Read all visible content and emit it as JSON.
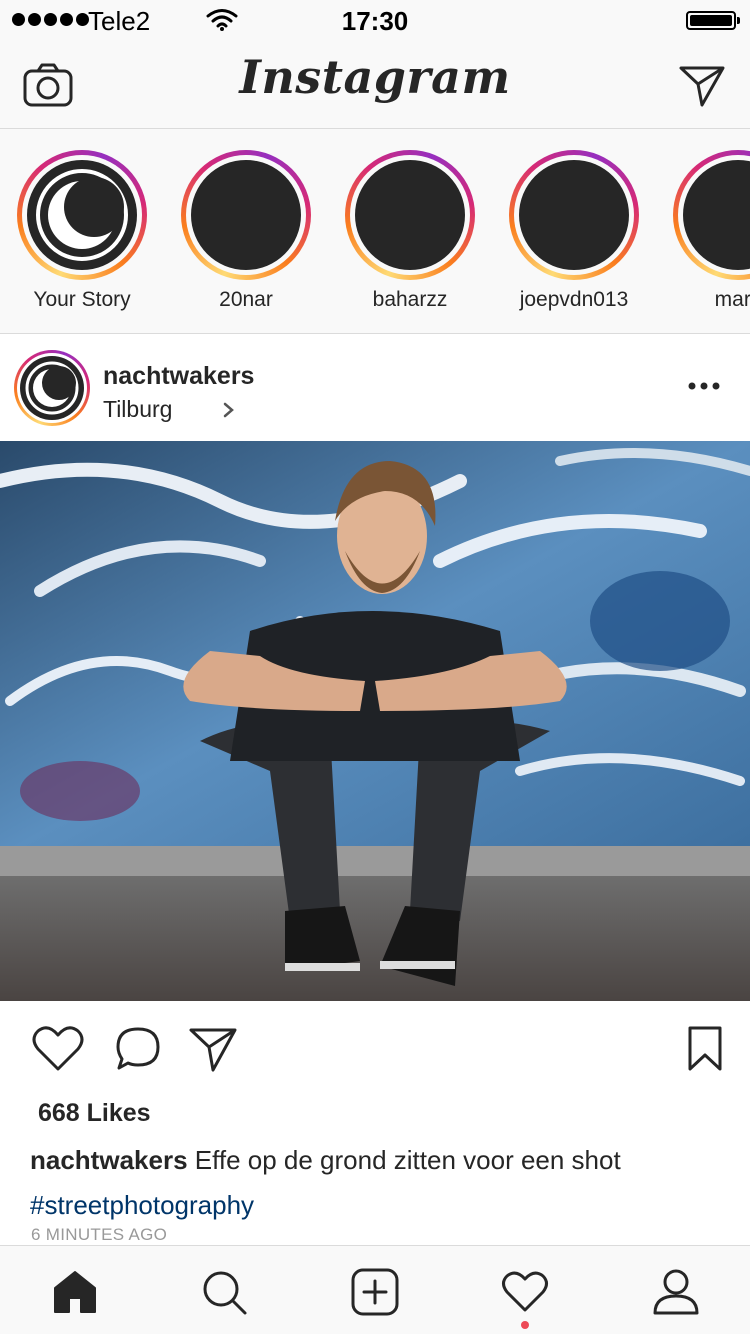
{
  "status_bar": {
    "carrier": "Tele2",
    "time": "17:30",
    "icons": [
      "signal-dots-icon",
      "wifi-icon",
      "battery-icon"
    ]
  },
  "header": {
    "logo": "Instagram",
    "icons": [
      "camera-icon",
      "direct-message-icon"
    ]
  },
  "stories": [
    {
      "name": "Your Story",
      "logo": true
    },
    {
      "name": "20nar"
    },
    {
      "name": "baharzz"
    },
    {
      "name": "joepvdn013"
    },
    {
      "name": "mark"
    }
  ],
  "post": {
    "username": "nachtwakers",
    "location": "Tilburg",
    "likes": "668 Likes",
    "caption_user": "nachtwakers",
    "caption_text": "Effe op de grond zitten voor een shot",
    "hashtag": "#streetphotography",
    "time_ago": "6 MINUTES AGO",
    "action_icons": [
      "heart-icon",
      "comment-icon",
      "share-icon",
      "bookmark-icon"
    ]
  },
  "tab_bar": {
    "tabs": [
      "home-icon",
      "search-icon",
      "add-post-icon",
      "activity-heart-icon",
      "profile-icon"
    ],
    "active": "home-icon",
    "notification_color": "#ed4956"
  }
}
